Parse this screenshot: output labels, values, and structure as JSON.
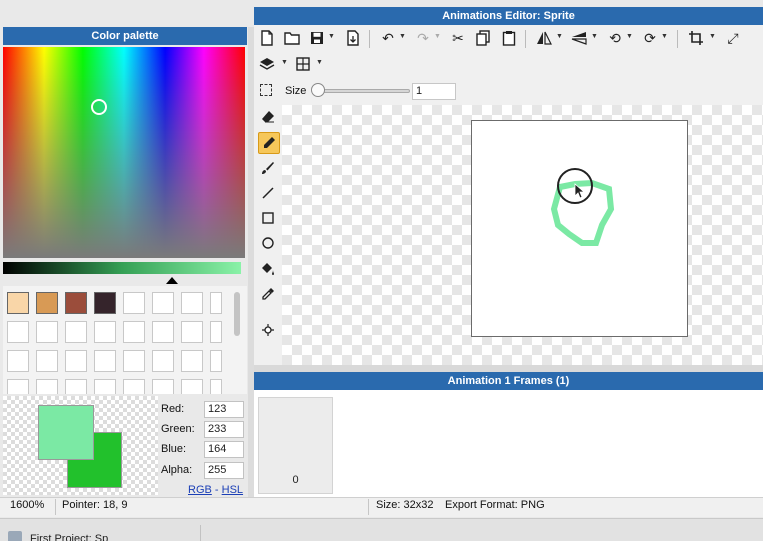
{
  "editor": {
    "title": "Animations Editor: Sprite",
    "size_label": "Size",
    "size_value": "1",
    "size_fraction": 0.02
  },
  "palette": {
    "title": "Color palette",
    "swatches": [
      "#f9d6a8",
      "#d89a55",
      "#9b4d3b",
      "#35242b"
    ],
    "primary": "#7be9a4",
    "secondary": "#22c12c"
  },
  "color": {
    "red_label": "Red:",
    "red": "123",
    "green_label": "Green:",
    "green": "233",
    "blue_label": "Blue:",
    "blue": "164",
    "alpha_label": "Alpha:",
    "alpha": "255",
    "rgb_link": "RGB",
    "dash": "-",
    "hsl_link": "HSL"
  },
  "frames": {
    "title": "Animation 1 Frames (1)",
    "items": [
      {
        "index": "0"
      }
    ]
  },
  "status": {
    "zoom": "1600%",
    "pointer": "Pointer: 18, 9",
    "size": "Size: 32x32",
    "export": "Export Format: PNG"
  },
  "taskbar": {
    "item": "First Project: Sp"
  },
  "icons": {
    "new": "new-file-icon",
    "open": "folder-icon",
    "save": "save-icon",
    "export": "export-icon",
    "undo": "undo-icon",
    "redo": "redo-icon",
    "cut": "scissors-icon",
    "copy": "copy-icon",
    "paste": "paste-icon",
    "flip-h": "flip-horizontal-icon",
    "flip-v": "flip-vertical-icon",
    "rotate-ccw": "rotate-ccw-icon",
    "rotate-cw": "rotate-cw-icon",
    "crop": "crop-icon",
    "resize": "resize-icon",
    "layers": "layers-icon",
    "grid": "grid-icon"
  }
}
